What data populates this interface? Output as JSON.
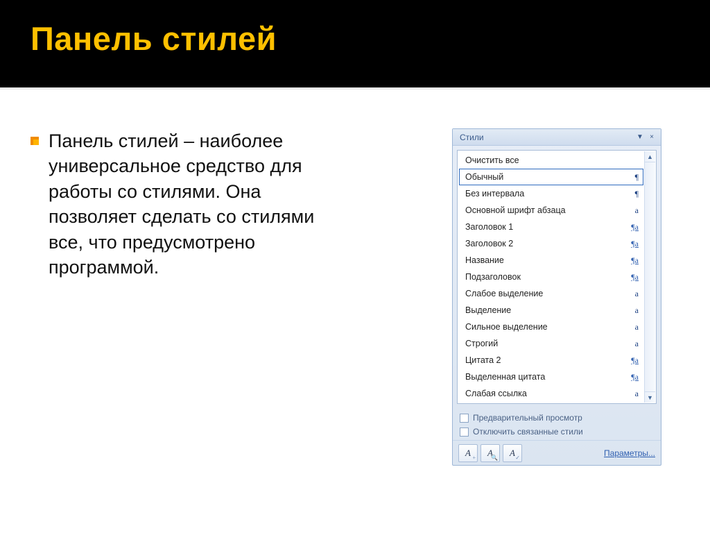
{
  "header": {
    "title": "Панель стилей"
  },
  "body": {
    "bullet_text": "Панель стилей – наиболее универсальное средство для работы со стилями. Она позволяет сделать со стилями все, что предусмотрено программой."
  },
  "pane": {
    "title": "Стили",
    "menu_glyph": "▼",
    "close_glyph": "×",
    "scroll_up_glyph": "▲",
    "scroll_dn_glyph": "▼",
    "items": [
      {
        "label": "Очистить все",
        "badge": "",
        "badge_class": "",
        "selected": false
      },
      {
        "label": "Обычный",
        "badge": "¶",
        "badge_class": "",
        "selected": true
      },
      {
        "label": "Без интервала",
        "badge": "¶",
        "badge_class": "",
        "selected": false
      },
      {
        "label": "Основной шрифт абзаца",
        "badge": "a",
        "badge_class": "",
        "selected": false
      },
      {
        "label": "Заголовок 1",
        "badge": "¶a",
        "badge_class": "link",
        "selected": false
      },
      {
        "label": "Заголовок 2",
        "badge": "¶a",
        "badge_class": "link",
        "selected": false
      },
      {
        "label": "Название",
        "badge": "¶a",
        "badge_class": "link",
        "selected": false
      },
      {
        "label": "Подзаголовок",
        "badge": "¶a",
        "badge_class": "link",
        "selected": false
      },
      {
        "label": "Слабое выделение",
        "badge": "a",
        "badge_class": "",
        "selected": false
      },
      {
        "label": "Выделение",
        "badge": "a",
        "badge_class": "",
        "selected": false
      },
      {
        "label": "Сильное выделение",
        "badge": "a",
        "badge_class": "",
        "selected": false
      },
      {
        "label": "Строгий",
        "badge": "a",
        "badge_class": "",
        "selected": false
      },
      {
        "label": "Цитата 2",
        "badge": "¶a",
        "badge_class": "link",
        "selected": false
      },
      {
        "label": "Выделенная цитата",
        "badge": "¶a",
        "badge_class": "link",
        "selected": false
      },
      {
        "label": "Слабая ссылка",
        "badge": "a",
        "badge_class": "",
        "selected": false
      }
    ],
    "checks": {
      "preview": "Предварительный просмотр",
      "disable_linked": "Отключить связанные стили"
    },
    "footer": {
      "btn1_glyph": "A",
      "btn2_glyph": "A",
      "btn3_glyph": "A",
      "options": "Параметры..."
    }
  }
}
